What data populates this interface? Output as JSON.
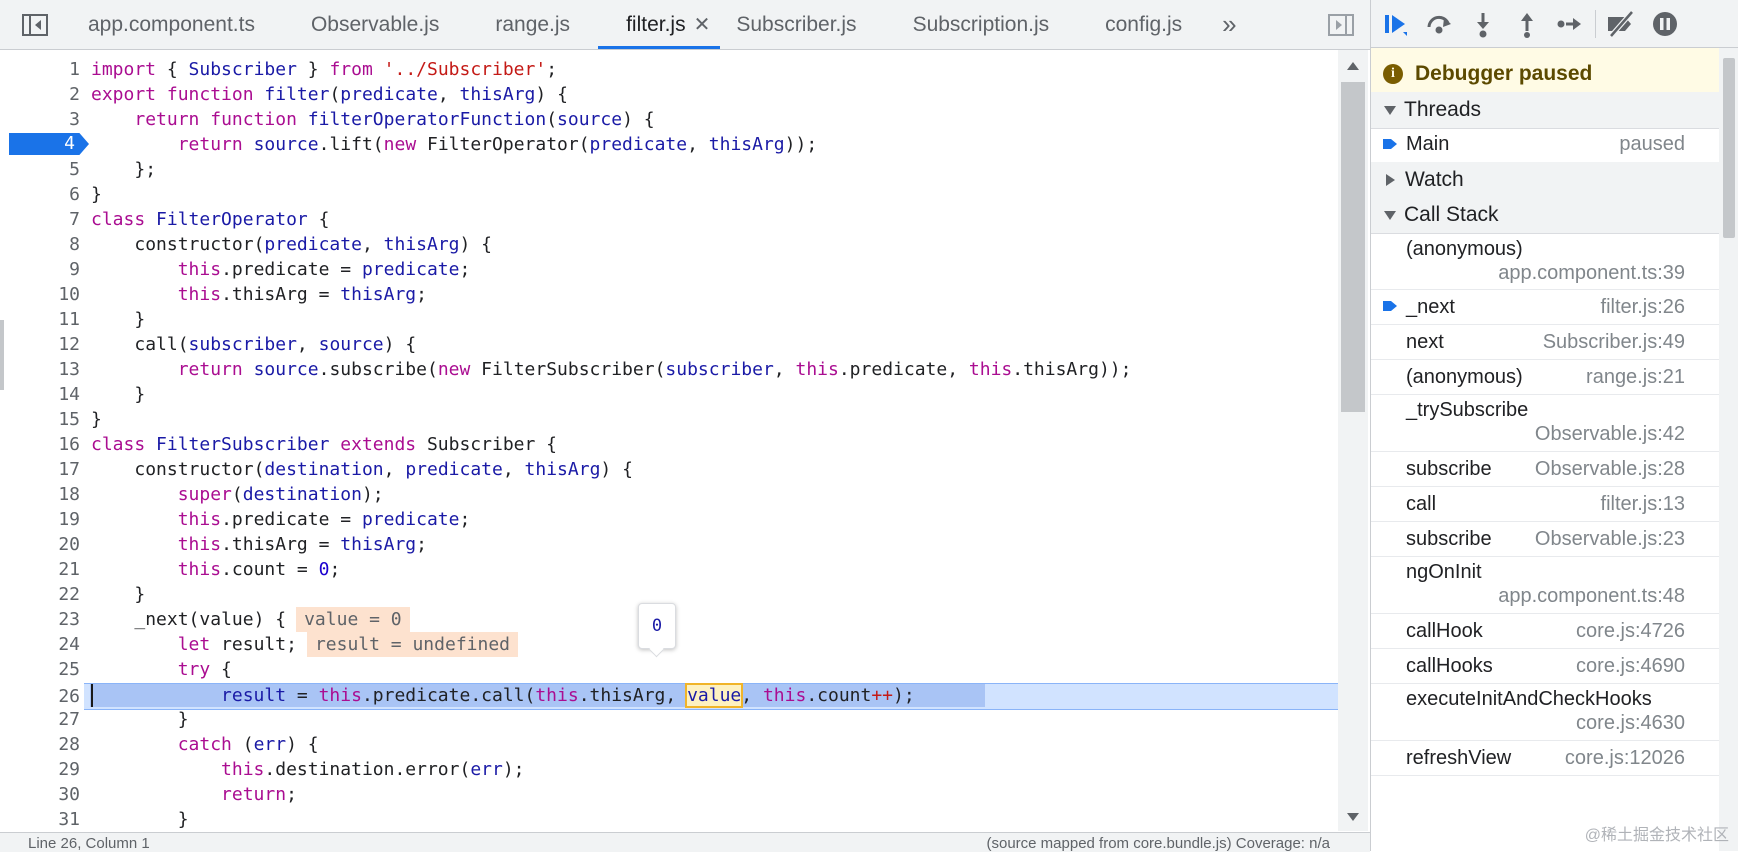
{
  "tabs": [
    {
      "label": "app.component.ts",
      "active": false
    },
    {
      "label": "Observable.js",
      "active": false
    },
    {
      "label": "range.js",
      "active": false
    },
    {
      "label": "filter.js",
      "active": true
    },
    {
      "label": "Subscriber.js",
      "active": false
    },
    {
      "label": "Subscription.js",
      "active": false
    },
    {
      "label": "config.js",
      "active": false
    }
  ],
  "tab_close_glyph": "✕",
  "tab_overflow_glyph": "»",
  "editor": {
    "breakpoint_line": "4",
    "current_line": "26",
    "hover_value": "0",
    "inline_values": {
      "line23": "value = 0",
      "line24": "result = undefined"
    },
    "line_numbers": [
      "1",
      "2",
      "3",
      "4",
      "5",
      "6",
      "7",
      "8",
      "9",
      "10",
      "11",
      "12",
      "13",
      "14",
      "15",
      "16",
      "17",
      "18",
      "19",
      "20",
      "21",
      "22",
      "23",
      "24",
      "25",
      "26",
      "27",
      "28",
      "29",
      "30",
      "31"
    ]
  },
  "code": {
    "l1": [
      "import",
      " { ",
      "Subscriber",
      " } ",
      "from",
      " ",
      "'../Subscriber'",
      ";"
    ],
    "l2": [
      "export",
      " ",
      "function",
      " ",
      "filter",
      "(",
      "predicate",
      ", ",
      "thisArg",
      ") {"
    ],
    "l3": [
      "return",
      " ",
      "function",
      " ",
      "filterOperatorFunction",
      "(",
      "source",
      ") {"
    ],
    "l4": [
      "return",
      " ",
      "source",
      ".lift(",
      "new",
      " FilterOperator(",
      "predicate",
      ", ",
      "thisArg",
      "));"
    ],
    "l5": "};",
    "l6": "}",
    "l7": [
      "class",
      " ",
      "FilterOperator",
      " {"
    ],
    "l8": [
      "constructor(",
      "predicate",
      ", ",
      "thisArg",
      ") {"
    ],
    "l9": [
      "this",
      ".predicate = ",
      "predicate",
      ";"
    ],
    "l10": [
      "this",
      ".thisArg = ",
      "thisArg",
      ";"
    ],
    "l11": "}",
    "l12": [
      "call(",
      "subscriber",
      ", ",
      "source",
      ") {"
    ],
    "l13": [
      "return",
      " ",
      "source",
      ".subscribe(",
      "new",
      " FilterSubscriber(",
      "subscriber",
      ", ",
      "this",
      ".predicate, ",
      "this",
      ".thisArg));"
    ],
    "l14": "}",
    "l15": "}",
    "l16": [
      "class",
      " ",
      "FilterSubscriber",
      " ",
      "extends",
      " Subscriber {"
    ],
    "l17": [
      "constructor(",
      "destination",
      ", ",
      "predicate",
      ", ",
      "thisArg",
      ") {"
    ],
    "l18": [
      "super",
      "(",
      "destination",
      ");"
    ],
    "l19": [
      "this",
      ".predicate = ",
      "predicate",
      ";"
    ],
    "l20": [
      "this",
      ".thisArg = ",
      "thisArg",
      ";"
    ],
    "l21": [
      "this",
      ".count = ",
      "0",
      ";"
    ],
    "l22": "}",
    "l23": [
      "_next(",
      "value",
      ") {"
    ],
    "l24": [
      "let",
      " ",
      "result",
      ";"
    ],
    "l25": [
      "try",
      " {"
    ],
    "l26": [
      "result",
      " = ",
      "this",
      ".predicate.call(",
      "this",
      ".thisArg, ",
      "value",
      ", ",
      "this",
      ".count",
      "++",
      ");"
    ],
    "l27": "}",
    "l28": [
      "catch",
      " (",
      "err",
      ") {"
    ],
    "l29": [
      "this",
      ".destination.error(",
      "err",
      ");"
    ],
    "l30": [
      "return",
      ";"
    ],
    "l31": "}"
  },
  "statusbar": {
    "left": "Line 26, Column 1",
    "right": "(source mapped from core.bundle.js)  Coverage: n/a"
  },
  "debugger": {
    "paused_text": "Debugger paused",
    "info_glyph": "i",
    "threads_label": "Threads",
    "thread": {
      "name": "Main",
      "status": "paused"
    },
    "watch_label": "Watch",
    "callstack_label": "Call Stack",
    "frames": [
      {
        "name": "(anonymous)",
        "loc": "app.component.ts:39"
      },
      {
        "name": "_next",
        "loc": "filter.js:26"
      },
      {
        "name": "next",
        "loc": "Subscriber.js:49"
      },
      {
        "name": "(anonymous)",
        "loc": "range.js:21"
      },
      {
        "name": "_trySubscribe",
        "loc": "Observable.js:42"
      },
      {
        "name": "subscribe",
        "loc": "Observable.js:28"
      },
      {
        "name": "call",
        "loc": "filter.js:13"
      },
      {
        "name": "subscribe",
        "loc": "Observable.js:23"
      },
      {
        "name": "ngOnInit",
        "loc": "app.component.ts:48"
      },
      {
        "name": "callHook",
        "loc": "core.js:4726"
      },
      {
        "name": "callHooks",
        "loc": "core.js:4690"
      },
      {
        "name": "executeInitAndCheckHooks",
        "loc": "core.js:4630"
      },
      {
        "name": "refreshView",
        "loc": "core.js:12026"
      }
    ]
  },
  "watermark": "@稀土掘金技术社区",
  "colors": {
    "accent": "#1a73e8",
    "paused_bg": "#fffbe5",
    "exec_line": "#d1e3ff"
  }
}
